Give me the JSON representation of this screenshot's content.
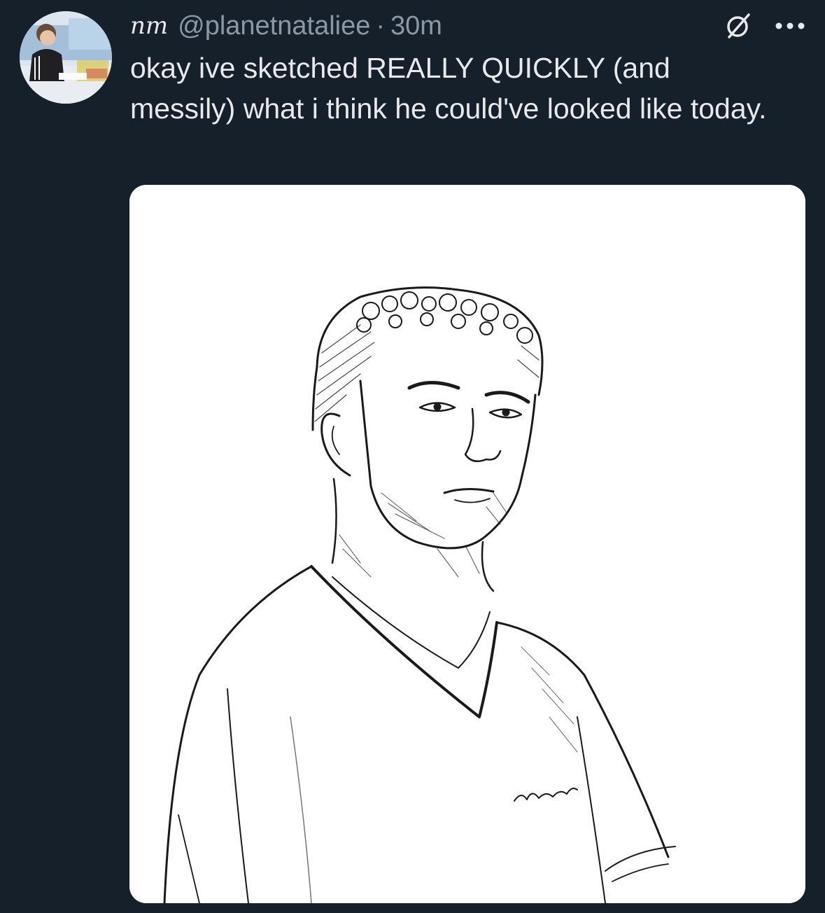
{
  "tweet": {
    "author": {
      "display_name": "nm",
      "handle": "@planetnataliee"
    },
    "separator": "·",
    "timestamp": "30m",
    "text": "okay ive sketched REALLY QUICKLY (and messily) what i think he could've looked like today.",
    "icons": {
      "status": "sandbox-icon",
      "more": "more-icon"
    }
  },
  "colors": {
    "background": "#16202a",
    "primary_text": "#e7e9ea",
    "secondary_text": "#8b98a5",
    "media_background": "#ffffff"
  }
}
